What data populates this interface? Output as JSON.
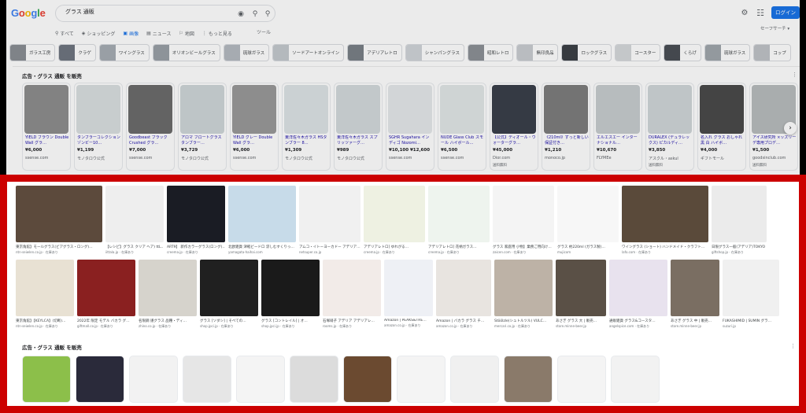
{
  "header": {
    "logo": "Google",
    "search_value": "グラス 通販",
    "login_label": "ログイン",
    "safe_search_label": "セーフサーチ ▾"
  },
  "tabs": [
    {
      "label": "すべて",
      "icon": "search-icon"
    },
    {
      "label": "ショッピング",
      "icon": "tag-icon"
    },
    {
      "label": "画像",
      "icon": "image-icon",
      "active": true
    },
    {
      "label": "ニュース",
      "icon": "news-icon"
    },
    {
      "label": "地図",
      "icon": "pin-icon"
    },
    {
      "label": "もっと見る",
      "icon": "more-icon"
    }
  ],
  "tools_label": "ツール",
  "chips": [
    "ガラス工房",
    "クラゲ",
    "ワイングラス",
    "オリオンビールグラス",
    "琉球ガラス",
    "ソードアートオンライン",
    "アデリアレトロ",
    "シャンパングラス",
    "昭和レトロ",
    "無印良品",
    "ロックグラス",
    "コースター",
    "くらげ",
    "琉球ガラス",
    "コップ"
  ],
  "ads_title": "広告・グラス 通販 を販売",
  "ads": [
    {
      "name": "YIELD ブラウン Double Wall グラ…",
      "price": "¥6,000",
      "store": "ssense.com",
      "ship": "",
      "color": "#8e8e8e"
    },
    {
      "name": "タンブラーコレクション ゾンビー10…",
      "price": "¥1,199",
      "store": "モノタロウ公式",
      "ship": "",
      "color": "#d9dfe0"
    },
    {
      "name": "Goodbeast ブラック Crushed グラ…",
      "price": "¥7,000",
      "store": "ssense.com",
      "ship": "",
      "color": "#6c6c6c"
    },
    {
      "name": "アロマ フロートグラス タンブラー…",
      "price": "¥3,729",
      "store": "モノタロウ公式",
      "ship": "",
      "color": "#cfd6d8"
    },
    {
      "name": "YIELD グレー Double Wall グラ…",
      "price": "¥6,000",
      "store": "ssense.com",
      "ship": "",
      "color": "#9a9a9a"
    },
    {
      "name": "東洋佐々木ガラス HSタンブラー 8…",
      "price": "¥1,309",
      "store": "モノタロウ公式",
      "ship": "",
      "color": "#dde3e5"
    },
    {
      "name": "東洋佐々木ガラス スプリッツァーグ…",
      "price": "¥989",
      "store": "モノタロウ公式",
      "ship": "",
      "color": "#d3dadc"
    },
    {
      "name": "SGHR Sugahara イン ディゴ Nozomi…",
      "price": "¥10,100 ¥12,600",
      "store": "ssense.com",
      "ship": "",
      "color": "#e4e8ea"
    },
    {
      "name": "NUDE Glass Club スモール ハイボール…",
      "price": "¥6,500",
      "store": "ssense.com",
      "ship": "",
      "color": "#e1e6e7"
    },
    {
      "name": "【公式】ディオール・ウォーターグラ…",
      "price": "¥45,000",
      "store": "Dior.com",
      "ship": "送料無料",
      "color": "#3a3f4a"
    },
    {
      "name": "《210ml》ずっと新しい保証付き…",
      "price": "¥1,210",
      "store": "monoco.jp",
      "ship": "",
      "color": "#7d7d7d"
    },
    {
      "name": "エルエスエー インターナショナル…",
      "price": "¥10,670",
      "store": "FLYMEe",
      "ship": "",
      "color": "#c7cdcf"
    },
    {
      "name": "DURALEX (デュラレックス) ピカルディ…",
      "price": "¥3,850",
      "store": "アスクル・askul",
      "ship": "送料無料",
      "color": "#d0d6d8"
    },
    {
      "name": "名入れ グラス おしゃれ 黒 白 ハイボ…",
      "price": "¥4,000",
      "store": "ギフトモール",
      "ship": "",
      "color": "#4a4a4a"
    },
    {
      "name": "アイス研究所 ×ッズリーデ専用プロデ…",
      "price": "¥1,500",
      "store": "goodsinclub.com",
      "ship": "送料無料",
      "color": "#b8bcbd"
    }
  ],
  "image_row1": [
    {
      "title": "東京角館】モールグラス(ビアグラス・ロング)…",
      "source": "ntn-seiwlen.co.jp · 在庫あり",
      "color": "#5c4a3c",
      "w": 110
    },
    {
      "title": "【レシピ】グラス クリア ヘア) ttL…",
      "source": "iittala.jp · 在庫あり",
      "color": "#eeeeee",
      "w": 74
    },
    {
      "title": "ART9】 新作カラーグラス(ロング)…",
      "source": "creema.jp · 在庫あり",
      "color": "#1a1c24",
      "w": 74
    },
    {
      "title": "北欧雑貨 津軽ビードロ 涼しむすくりっ…",
      "source": "yamagata-haihai.com",
      "color": "#c7dbe9",
      "w": 86
    },
    {
      "title": "アムコ・イトーヨーカドー アデリア…",
      "source": "netsuper.co.jp",
      "color": "#f0f0f0",
      "w": 78
    },
    {
      "title": "アデリアレトロ] ゆれがる…",
      "source": "creema.jp · 在庫あり",
      "color": "#eef1e2",
      "w": 78
    },
    {
      "title": "アデリアレトロ] 花柄ガラス…",
      "source": "creema.jp · 在庫あり",
      "color": "#eef4ee",
      "w": 78
    },
    {
      "title": "グラス 家庭用 小物】業務ご用向け…",
      "source": "zaicen.com · 在庫あり",
      "color": "#f4f4f4",
      "w": 78
    },
    {
      "title": "グラス 約220ml (ガラス製)…",
      "source": "mujicom",
      "color": "#f7f7f7",
      "w": 78
    },
    {
      "title": "ワイングラス (ショート) ハンドメイド・クラフト…",
      "source": "lafo.com · 在庫あり",
      "color": "#5a4a3a",
      "w": 110
    },
    {
      "title": "日限グラス一般(アデリア)TOKYO",
      "source": "giftshop.jp · 在庫あり",
      "color": "#ebebeb",
      "w": 70
    }
  ],
  "image_row2": [
    {
      "title": "東京角館】【KEYLCA】(切断)…",
      "source": "ntn-seiwlen.co.jp · 在庫あり",
      "color": "#e8e1d3",
      "w": 74
    },
    {
      "title": "2022年 限定 モデル バカラ グ…",
      "source": "giftmall.co.jp · 在庫あり",
      "color": "#8a2020",
      "w": 74
    },
    {
      "title": "名限鋼 謹グラス 品種・ディ…",
      "source": "zhino.co.jp · 在庫あり",
      "color": "#d6d3cc",
      "w": 74
    },
    {
      "title": "グラス [ソダシ] | そべての…",
      "source": "shop.jpci.jp · 在庫あり",
      "color": "#202020",
      "w": 74
    },
    {
      "title": "グラス [コントレイル] | オ…",
      "source": "shop.jpci.jp · 在庫あり",
      "color": "#1a1a1a",
      "w": 74
    },
    {
      "title": "石塚硝子 アデリア アデリアレ…",
      "source": "rooms.jp · 在庫あり",
      "color": "#f2ebe8",
      "w": 74
    },
    {
      "title": "Amazon | PEAKS&TRE…",
      "source": "amazon.co.jp · 在庫あり",
      "color": "#eef0f5",
      "w": 62
    },
    {
      "title": "Amazon | バカラ グラス チ…",
      "source": "amazon.co.jp · 在庫あり",
      "color": "#e8e4e0",
      "w": 70
    },
    {
      "title": "Stöölzle(シュトルツル) VULC…",
      "source": "mercari.co.jp · 在庫あり",
      "color": "#bdb2a6",
      "w": 74
    },
    {
      "title": "あさぎ グラス 大 | 販売…",
      "source": "store.minne-beer.jp",
      "color": "#5a5046",
      "w": 64
    },
    {
      "title": "通販雑貨 グラス&コースタ…",
      "source": "angelspice.com · 在庫あり",
      "color": "#e8e2ee",
      "w": 74
    },
    {
      "title": "あさぎ グラス 中 | 販売…",
      "source": "store.minne-beer.jp",
      "color": "#7a6e62",
      "w": 62
    },
    {
      "title": "FUKASHIMID | SUMIN グラ…",
      "source": "suzuri.jp",
      "color": "#f0f0f0",
      "w": 72
    }
  ],
  "ads2_title": "広告・グラス 通販 を販売",
  "ads2_colors": [
    "#8cbf4a",
    "#2a2a3a",
    "#f2f2f2",
    "#e6e6e6",
    "#f4f4f4",
    "#dcdcdc",
    "#6b4a30",
    "#f4f4f4",
    "#f0f0f0",
    "#8a7a6a",
    "#f4f4f4",
    "#f2f2f2"
  ],
  "colors": {
    "highlight": "#cc0000",
    "accent": "#1a73e8"
  }
}
